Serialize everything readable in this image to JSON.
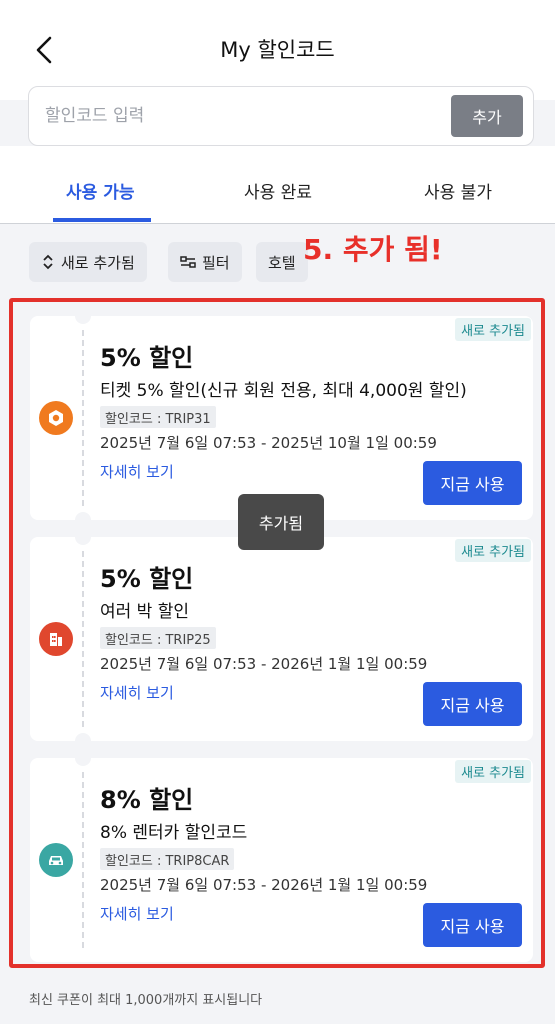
{
  "header": {
    "title": "My 할인코드",
    "back_icon": "chevron-left-icon"
  },
  "search": {
    "placeholder": "할인코드 입력",
    "value": "",
    "button_label": "추가"
  },
  "tabs": [
    {
      "label": "사용 가능",
      "active": true
    },
    {
      "label": "사용 완료",
      "active": false
    },
    {
      "label": "사용 불가",
      "active": false
    }
  ],
  "filters": [
    {
      "label": "새로 추가됨",
      "icon": "sort-icon"
    },
    {
      "label": "필터",
      "icon": "filter-icon"
    },
    {
      "label": "호텔",
      "icon": ""
    }
  ],
  "annotation": "5. 추가 됨!",
  "coupons": [
    {
      "badge": "새로 추가됨",
      "title": "5% 할인",
      "description": "티켓 5% 할인(신규 회원 전용, 최대 4,000원 할인)",
      "code": "할인코드 : TRIP31",
      "validity": "2025년 7월 6일 07:53 - 2025년 10월 1일 00:59",
      "details_label": "자세히 보기",
      "use_label": "지금 사용",
      "icon": "ticket-icon",
      "icon_color": "#f07a1f"
    },
    {
      "badge": "새로 추가됨",
      "title": "5% 할인",
      "description": "여러 박 할인",
      "code": "할인코드 : TRIP25",
      "validity": "2025년 7월 6일 07:53 - 2026년 1월 1일 00:59",
      "details_label": "자세히 보기",
      "use_label": "지금 사용",
      "icon": "hotel-icon",
      "icon_color": "#e0472e"
    },
    {
      "badge": "새로 추가됨",
      "title": "8% 할인",
      "description": "8% 렌터카 할인코드",
      "code": "할인코드 : TRIP8CAR",
      "validity": "2025년 7월 6일 07:53 - 2026년 1월 1일 00:59",
      "details_label": "자세히 보기",
      "use_label": "지금 사용",
      "icon": "car-icon",
      "icon_color": "#3aa7a3"
    }
  ],
  "toast": "추가됨",
  "footer_note": "최신 쿠폰이 최대 1,000개까지 표시됩니다",
  "colors": {
    "accent": "#2b5be0",
    "annotation_red": "#e3312b"
  }
}
